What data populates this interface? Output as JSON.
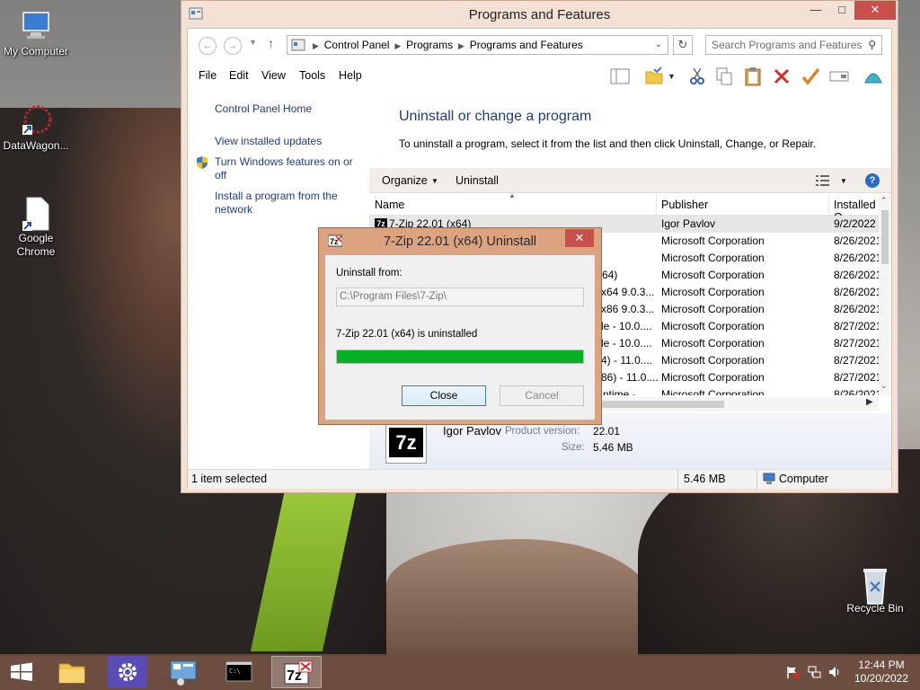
{
  "desktop": {
    "icons": [
      {
        "label": "My Computer"
      },
      {
        "label": "DataWagon..."
      },
      {
        "label": "Google Chrome"
      },
      {
        "label": "Recycle Bin"
      }
    ]
  },
  "window": {
    "title": "Programs and Features",
    "address": {
      "crumbs": [
        "Control Panel",
        "Programs",
        "Programs and Features"
      ],
      "search_placeholder": "Search Programs and Features"
    },
    "menu": [
      "File",
      "Edit",
      "View",
      "Tools",
      "Help"
    ],
    "sidebar": {
      "links": [
        "Control Panel Home",
        "View installed updates",
        "Turn Windows features on or off",
        "Install a program from the network"
      ]
    },
    "heading": "Uninstall or change a program",
    "description": "To uninstall a program, select it from the list and then click Uninstall, Change, or Repair.",
    "commands": {
      "organize": "Organize",
      "uninstall": "Uninstall"
    },
    "columns": {
      "name": "Name",
      "publisher": "Publisher",
      "installed": "Installed O"
    },
    "rows": [
      {
        "name": "7-Zip 22.01 (x64)",
        "publisher": "Igor Pavlov",
        "date": "9/2/2022"
      },
      {
        "name": "",
        "publisher": "Microsoft Corporation",
        "date": "8/26/2021"
      },
      {
        "name": "",
        "publisher": "Microsoft Corporation",
        "date": "8/26/2021"
      },
      {
        "name": "64)",
        "publisher": "Microsoft Corporation",
        "date": "8/26/2021"
      },
      {
        "name": "x64 9.0.3...",
        "publisher": "Microsoft Corporation",
        "date": "8/26/2021"
      },
      {
        "name": "x86 9.0.3...",
        "publisher": "Microsoft Corporation",
        "date": "8/26/2021"
      },
      {
        "name": "le - 10.0....",
        "publisher": "Microsoft Corporation",
        "date": "8/27/2021"
      },
      {
        "name": "le - 10.0....",
        "publisher": "Microsoft Corporation",
        "date": "8/27/2021"
      },
      {
        "name": "4) - 11.0....",
        "publisher": "Microsoft Corporation",
        "date": "8/27/2021"
      },
      {
        "name": "86) - 11.0....",
        "publisher": "Microsoft Corporation",
        "date": "8/27/2021"
      },
      {
        "name": "ntime -",
        "publisher": "Microsoft Corporation",
        "date": "8/26/2021"
      }
    ],
    "details": {
      "publisher": "Igor Pavlov",
      "version_label": "Product version:",
      "version": "22.01",
      "size_label": "Size:",
      "size": "5.46 MB"
    },
    "status": {
      "selected": "1 item selected",
      "size": "5.46 MB",
      "zone": "Computer"
    }
  },
  "dialog": {
    "title": "7-Zip 22.01 (x64) Uninstall",
    "uninstall_from_label": "Uninstall from:",
    "path": "C:\\Program Files\\7-Zip\\",
    "message": "7-Zip 22.01 (x64) is uninstalled",
    "progress": 100,
    "progress_color": "#06b025",
    "close": "Close",
    "cancel": "Cancel"
  },
  "taskbar": {
    "time": "12:44 PM",
    "date": "10/20/2022"
  }
}
